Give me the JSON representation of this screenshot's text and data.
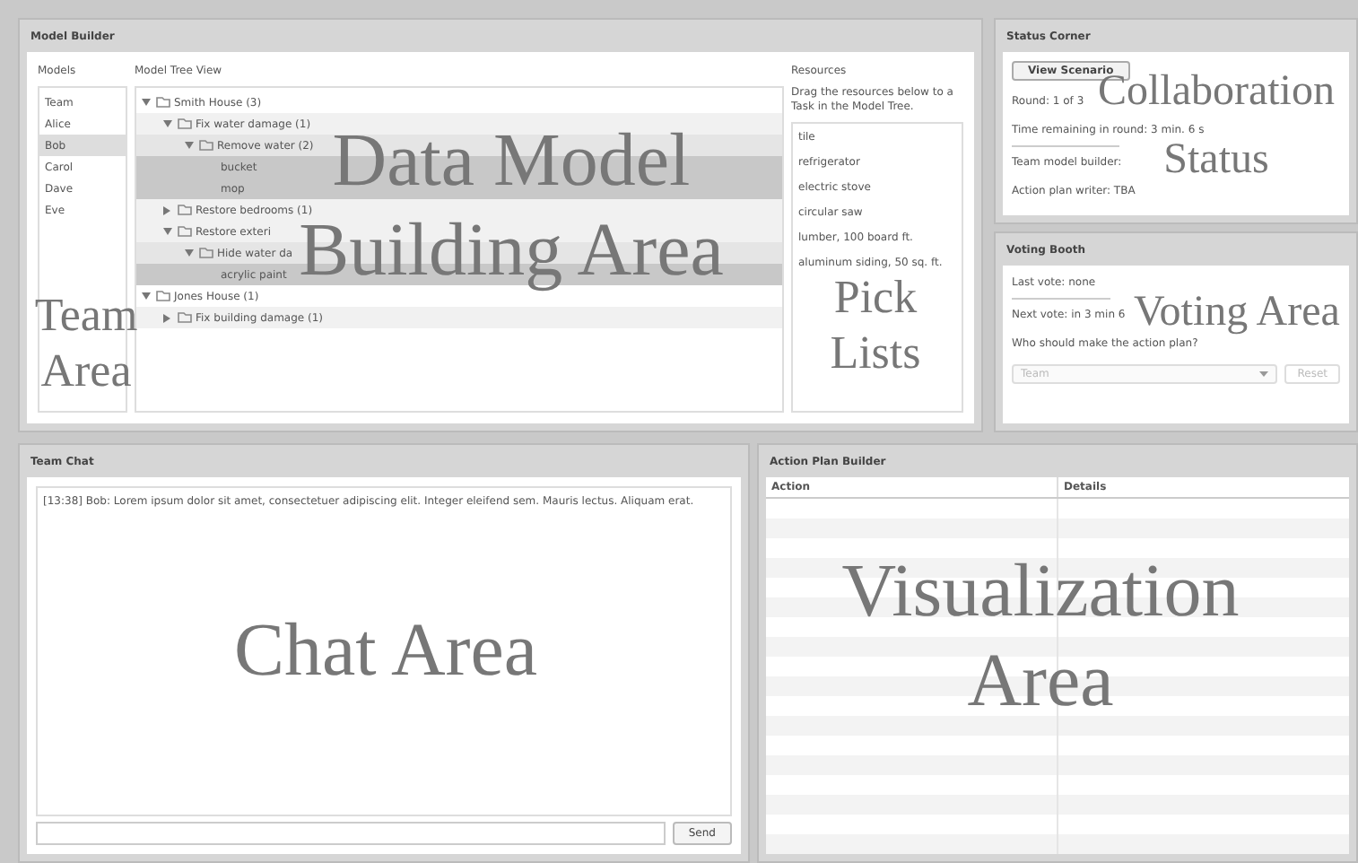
{
  "model_builder": {
    "title": "Model Builder",
    "models": {
      "label": "Models",
      "items": [
        {
          "name": "Team",
          "selected": false
        },
        {
          "name": "Alice",
          "selected": false
        },
        {
          "name": "Bob",
          "selected": true
        },
        {
          "name": "Carol",
          "selected": false
        },
        {
          "name": "Dave",
          "selected": false
        },
        {
          "name": "Eve",
          "selected": false
        }
      ]
    },
    "tree": {
      "label": "Model Tree View",
      "items": [
        {
          "kind": "folder",
          "label": "Smith House (3)",
          "expanded": true,
          "children": [
            {
              "kind": "folder",
              "label": "Fix water damage (1)",
              "expanded": true,
              "children": [
                {
                  "kind": "folder",
                  "label": "Remove water (2)",
                  "expanded": true,
                  "children": [
                    {
                      "kind": "resource",
                      "label": "bucket"
                    },
                    {
                      "kind": "resource",
                      "label": "mop"
                    }
                  ]
                }
              ]
            },
            {
              "kind": "folder",
              "label": "Restore bedrooms (1)",
              "expanded": false
            },
            {
              "kind": "folder",
              "label": "Restore exteri",
              "expanded": true,
              "children": [
                {
                  "kind": "folder",
                  "label": "Hide water da",
                  "expanded": true,
                  "children": [
                    {
                      "kind": "resource",
                      "label": "acrylic paint"
                    }
                  ]
                }
              ]
            }
          ]
        },
        {
          "kind": "folder",
          "label": "Jones House (1)",
          "expanded": true,
          "children": [
            {
              "kind": "folder",
              "label": "Fix building damage (1)",
              "expanded": false
            }
          ]
        }
      ]
    },
    "resources": {
      "label": "Resources",
      "hint": "Drag the resources below to a Task in the Model Tree.",
      "items": [
        "tile",
        "refrigerator",
        "electric stove",
        "circular saw",
        "lumber, 100 board ft.",
        "aluminum siding, 50 sq. ft."
      ]
    }
  },
  "status_corner": {
    "title": "Status Corner",
    "button": "View Scenario",
    "lines": [
      "Round: 1 of 3",
      "Time remaining in round: 3 min. 6 s",
      "Team model builder:",
      "Action plan writer: TBA"
    ]
  },
  "voting_booth": {
    "title": "Voting Booth",
    "last_vote": "Last vote: none",
    "next_vote": "Next vote: in 3 min 6",
    "question": "Who should make the action plan?",
    "select": {
      "value": "Team",
      "disabled": true
    },
    "reset": {
      "label": "Reset",
      "disabled": true
    }
  },
  "team_chat": {
    "title": "Team Chat",
    "messages": [
      "[13:38] Bob: Lorem ipsum dolor sit amet, consectetuer adipiscing elit. Integer eleifend sem. Mauris lectus. Aliquam erat."
    ],
    "send": "Send"
  },
  "action_plan": {
    "title": "Action Plan Builder",
    "columns": [
      "Action",
      "Details"
    ]
  },
  "annotations": [
    {
      "kind": "big",
      "lines": [
        "Data Model",
        "Building Area"
      ]
    },
    {
      "kind": "small",
      "lines": [
        "Team",
        "Area"
      ]
    },
    {
      "kind": "small",
      "lines": [
        "Pick",
        "Lists"
      ]
    },
    {
      "kind": "small",
      "lines": [
        "Collaboration",
        "Status"
      ]
    },
    {
      "kind": "small",
      "lines": [
        "Voting Area"
      ]
    },
    {
      "kind": "big",
      "lines": [
        "Chat Area"
      ]
    },
    {
      "kind": "big",
      "lines": [
        "Visualization",
        "Area"
      ]
    }
  ]
}
